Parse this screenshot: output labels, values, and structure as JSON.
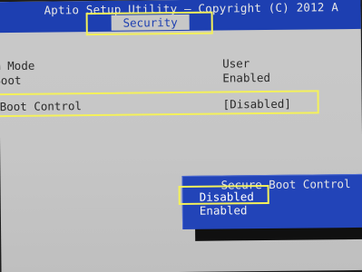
{
  "header": {
    "title": "Aptio Setup Utility – Copyright (C) 2012 A",
    "active_tab": "Security"
  },
  "settings": [
    {
      "label": "m Mode",
      "value": "User"
    },
    {
      "label": "Boot",
      "value": "Enabled"
    },
    {
      "label": "Boot Control",
      "value": "[Disabled]"
    }
  ],
  "popup": {
    "title": "Secure Boot Control",
    "options": [
      "Disabled",
      "Enabled"
    ],
    "selected": "Disabled"
  },
  "colors": {
    "bios_blue": "#1d3fb1",
    "panel_gray": "#c7c7c7",
    "highlight_yellow": "#f4f15a"
  }
}
